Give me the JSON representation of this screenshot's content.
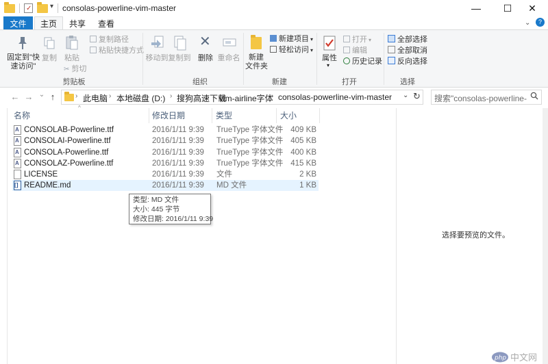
{
  "window": {
    "title": "consolas-powerline-vim-master",
    "controls": {
      "minimize": "—",
      "maximize": "☐",
      "close": "✕"
    }
  },
  "ribbon_tabs": [
    "文件",
    "主页",
    "共享",
    "查看"
  ],
  "ribbon": {
    "clipboard": {
      "label": "剪贴板",
      "pin": "固定到\"快\n速访问\"",
      "copy": "复制",
      "paste": "粘贴",
      "copy_path": "复制路径",
      "paste_shortcut": "粘贴快捷方式",
      "cut": "剪切"
    },
    "organize": {
      "label": "组织",
      "move_to": "移动到",
      "copy_to": "复制到",
      "delete": "删除",
      "rename": "重命名"
    },
    "new": {
      "label": "新建",
      "new_folder": "新建\n文件夹",
      "new_item": "新建项目",
      "easy_access": "轻松访问"
    },
    "open": {
      "label": "打开",
      "properties": "属性",
      "open": "打开",
      "edit": "编辑",
      "history": "历史记录"
    },
    "select": {
      "label": "选择",
      "select_all": "全部选择",
      "select_none": "全部取消",
      "invert": "反向选择"
    }
  },
  "navigation": {
    "back": "←",
    "forward": "→",
    "recent": "⌄",
    "up": "↑",
    "breadcrumbs": [
      "此电脑",
      "本地磁盘 (D:)",
      "搜狗高速下载",
      "vim-airline字体",
      "consolas-powerline-vim-master"
    ],
    "refresh": "↻",
    "search_placeholder": "搜索\"consolas-powerline-vi..."
  },
  "columns": [
    "名称",
    "修改日期",
    "类型",
    "大小"
  ],
  "files": [
    {
      "name": "CONSOLAB-Powerline.ttf",
      "date": "2016/1/11 9:39",
      "type": "TrueType 字体文件",
      "size": "409 KB"
    },
    {
      "name": "CONSOLAI-Powerline.ttf",
      "date": "2016/1/11 9:39",
      "type": "TrueType 字体文件",
      "size": "405 KB"
    },
    {
      "name": "CONSOLA-Powerline.ttf",
      "date": "2016/1/11 9:39",
      "type": "TrueType 字体文件",
      "size": "400 KB"
    },
    {
      "name": "CONSOLAZ-Powerline.ttf",
      "date": "2016/1/11 9:39",
      "type": "TrueType 字体文件",
      "size": "415 KB"
    },
    {
      "name": "LICENSE",
      "date": "2016/1/11 9:39",
      "type": "文件",
      "size": "2 KB"
    },
    {
      "name": "README.md",
      "date": "2016/1/11 9:39",
      "type": "MD 文件",
      "size": "1 KB"
    }
  ],
  "tooltip": {
    "type_line": "类型: MD 文件",
    "size_line": "大小: 445 字节",
    "date_line": "修改日期: 2016/1/11 9:39"
  },
  "preview": {
    "message": "选择要预览的文件。"
  },
  "watermark": {
    "text": "php 中文网"
  },
  "colors": {
    "accent": "#1979ca",
    "hover_row": "#e5f3ff",
    "folder": "#f4c644"
  }
}
